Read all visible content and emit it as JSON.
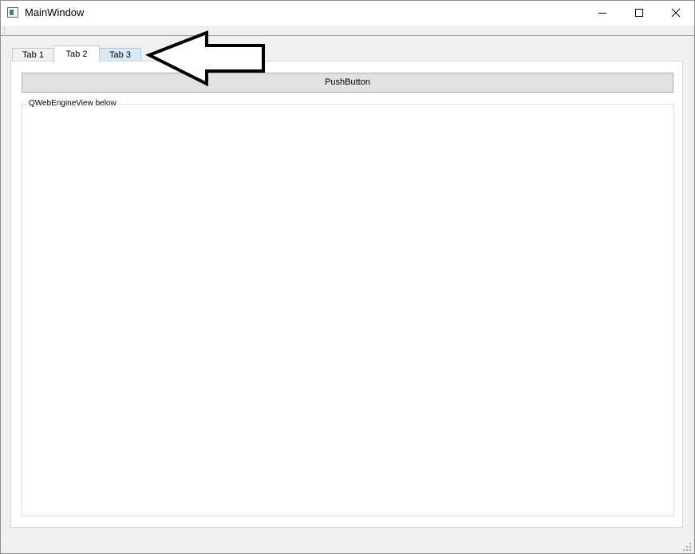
{
  "window": {
    "title": "MainWindow"
  },
  "icons": {
    "app": "app-window-icon",
    "minimize": "minimize-icon",
    "maximize": "maximize-icon",
    "close": "close-icon",
    "arrow": "left-arrow-annotation-icon",
    "size_grip": "size-grip-icon"
  },
  "tabs": [
    {
      "label": "Tab 1",
      "selected": false,
      "hovered": false
    },
    {
      "label": "Tab 2",
      "selected": true,
      "hovered": false
    },
    {
      "label": "Tab 3",
      "selected": false,
      "hovered": true
    }
  ],
  "panel": {
    "push_button_label": "PushButton",
    "group_title": "QWebEngineView below"
  },
  "colors": {
    "titlebar": "#ffffff",
    "window_bg": "#f0f0f0",
    "tab_hover": "#d9e9f7",
    "button_bg": "#e1e1e1",
    "arrow_stroke": "#000000"
  }
}
